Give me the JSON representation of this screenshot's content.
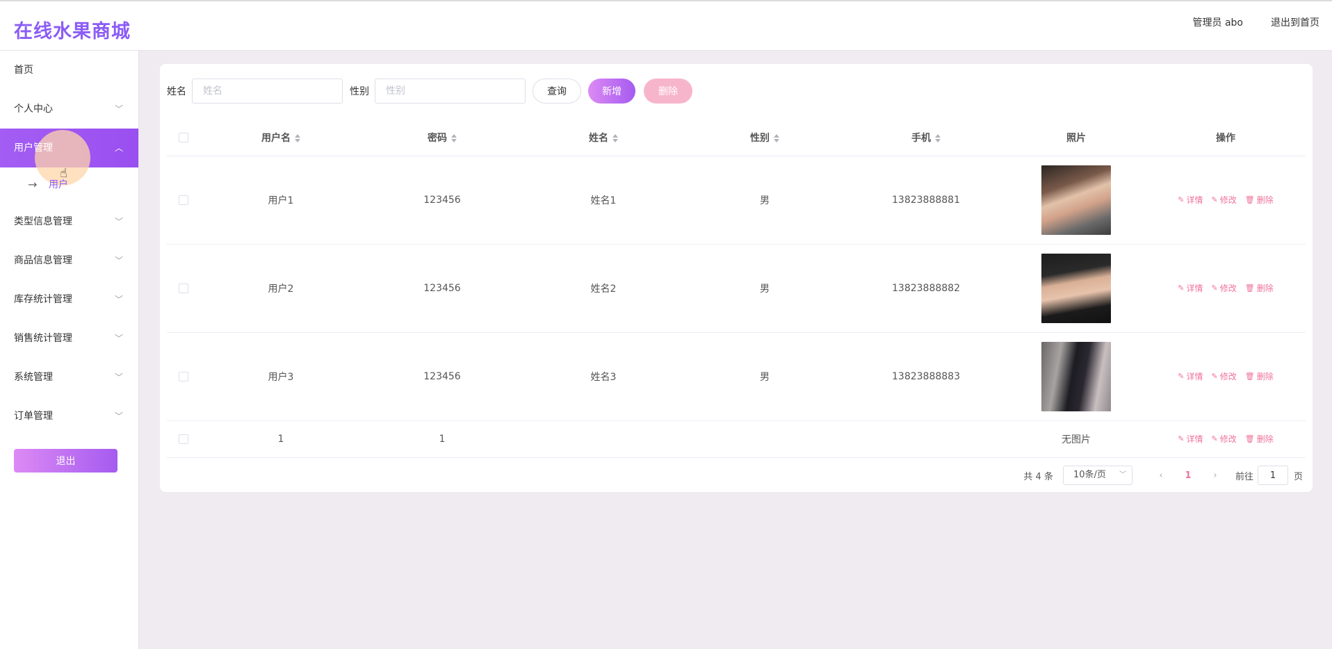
{
  "header": {
    "logo": "在线水果商城",
    "admin_label": "管理员 abo",
    "back_home": "退出到首页"
  },
  "sidebar": {
    "items": [
      {
        "label": "首页",
        "has_chevron": false
      },
      {
        "label": "个人中心",
        "has_chevron": true
      },
      {
        "label": "用户管理",
        "has_chevron": true,
        "active": true
      },
      {
        "label": "类型信息管理",
        "has_chevron": true
      },
      {
        "label": "商品信息管理",
        "has_chevron": true
      },
      {
        "label": "库存统计管理",
        "has_chevron": true
      },
      {
        "label": "销售统计管理",
        "has_chevron": true
      },
      {
        "label": "系统管理",
        "has_chevron": true
      },
      {
        "label": "订单管理",
        "has_chevron": true
      }
    ],
    "submenu": {
      "label": "用户"
    },
    "logout": "退出"
  },
  "search": {
    "name_label": "姓名",
    "name_placeholder": "姓名",
    "gender_label": "性别",
    "gender_placeholder": "性别",
    "query": "查询",
    "add": "新增",
    "delete": "删除"
  },
  "table": {
    "columns": [
      "用户名",
      "密码",
      "姓名",
      "性别",
      "手机",
      "照片",
      "操作"
    ],
    "rows": [
      {
        "username": "用户1",
        "password": "123456",
        "name": "姓名1",
        "gender": "男",
        "phone": "13823888881",
        "photo": "photo-1"
      },
      {
        "username": "用户2",
        "password": "123456",
        "name": "姓名2",
        "gender": "男",
        "phone": "13823888882",
        "photo": "photo-2"
      },
      {
        "username": "用户3",
        "password": "123456",
        "name": "姓名3",
        "gender": "男",
        "phone": "13823888883",
        "photo": "photo-3"
      },
      {
        "username": "1",
        "password": "1",
        "name": "",
        "gender": "",
        "phone": "",
        "photo_text": "无图片"
      }
    ],
    "actions": {
      "detail": "详情",
      "edit": "修改",
      "delete": "删除"
    }
  },
  "pagination": {
    "total": "共 4 条",
    "page_size": "10条/页",
    "current_page": "1",
    "goto_prefix": "前往",
    "goto_value": "1",
    "goto_suffix": "页"
  },
  "colors": {
    "accent": "#a259f2",
    "logo": "#8b5cf6",
    "danger_link": "#f0739a"
  }
}
